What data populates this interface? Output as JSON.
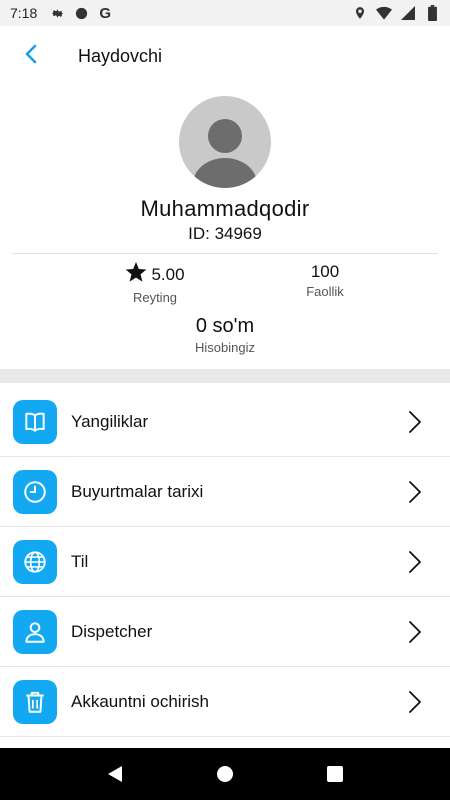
{
  "status_bar": {
    "time": "7:18",
    "left_icons": [
      "gear-icon",
      "circle-icon",
      "google-icon"
    ],
    "google_letter": "G",
    "right_icons": [
      "location-icon",
      "wifi-icon",
      "signal-icon",
      "battery-icon"
    ]
  },
  "header": {
    "title": "Haydovchi",
    "back_icon": "chevron-left-icon",
    "accent": "#1a9ee8"
  },
  "profile": {
    "name": "Muhammadqodir",
    "id_label": "ID: 34969",
    "rating_value": "5.00",
    "rating_label": "Reyting",
    "activity_value": "100",
    "activity_label": "Faollik",
    "balance_value": "0 so'm",
    "balance_label": "Hisobingiz"
  },
  "menu": {
    "icon_color": "#13a9f2",
    "items": [
      {
        "label": "Yangiliklar",
        "icon": "book-icon"
      },
      {
        "label": "Buyurtmalar tarixi",
        "icon": "clock-icon"
      },
      {
        "label": "Til",
        "icon": "globe-icon"
      },
      {
        "label": "Dispetcher",
        "icon": "user-icon"
      },
      {
        "label": "Akkauntni ochirish",
        "icon": "trash-icon"
      }
    ]
  },
  "nav_bar": {
    "buttons": [
      "back-triangle-icon",
      "home-circle-icon",
      "recents-square-icon"
    ]
  }
}
